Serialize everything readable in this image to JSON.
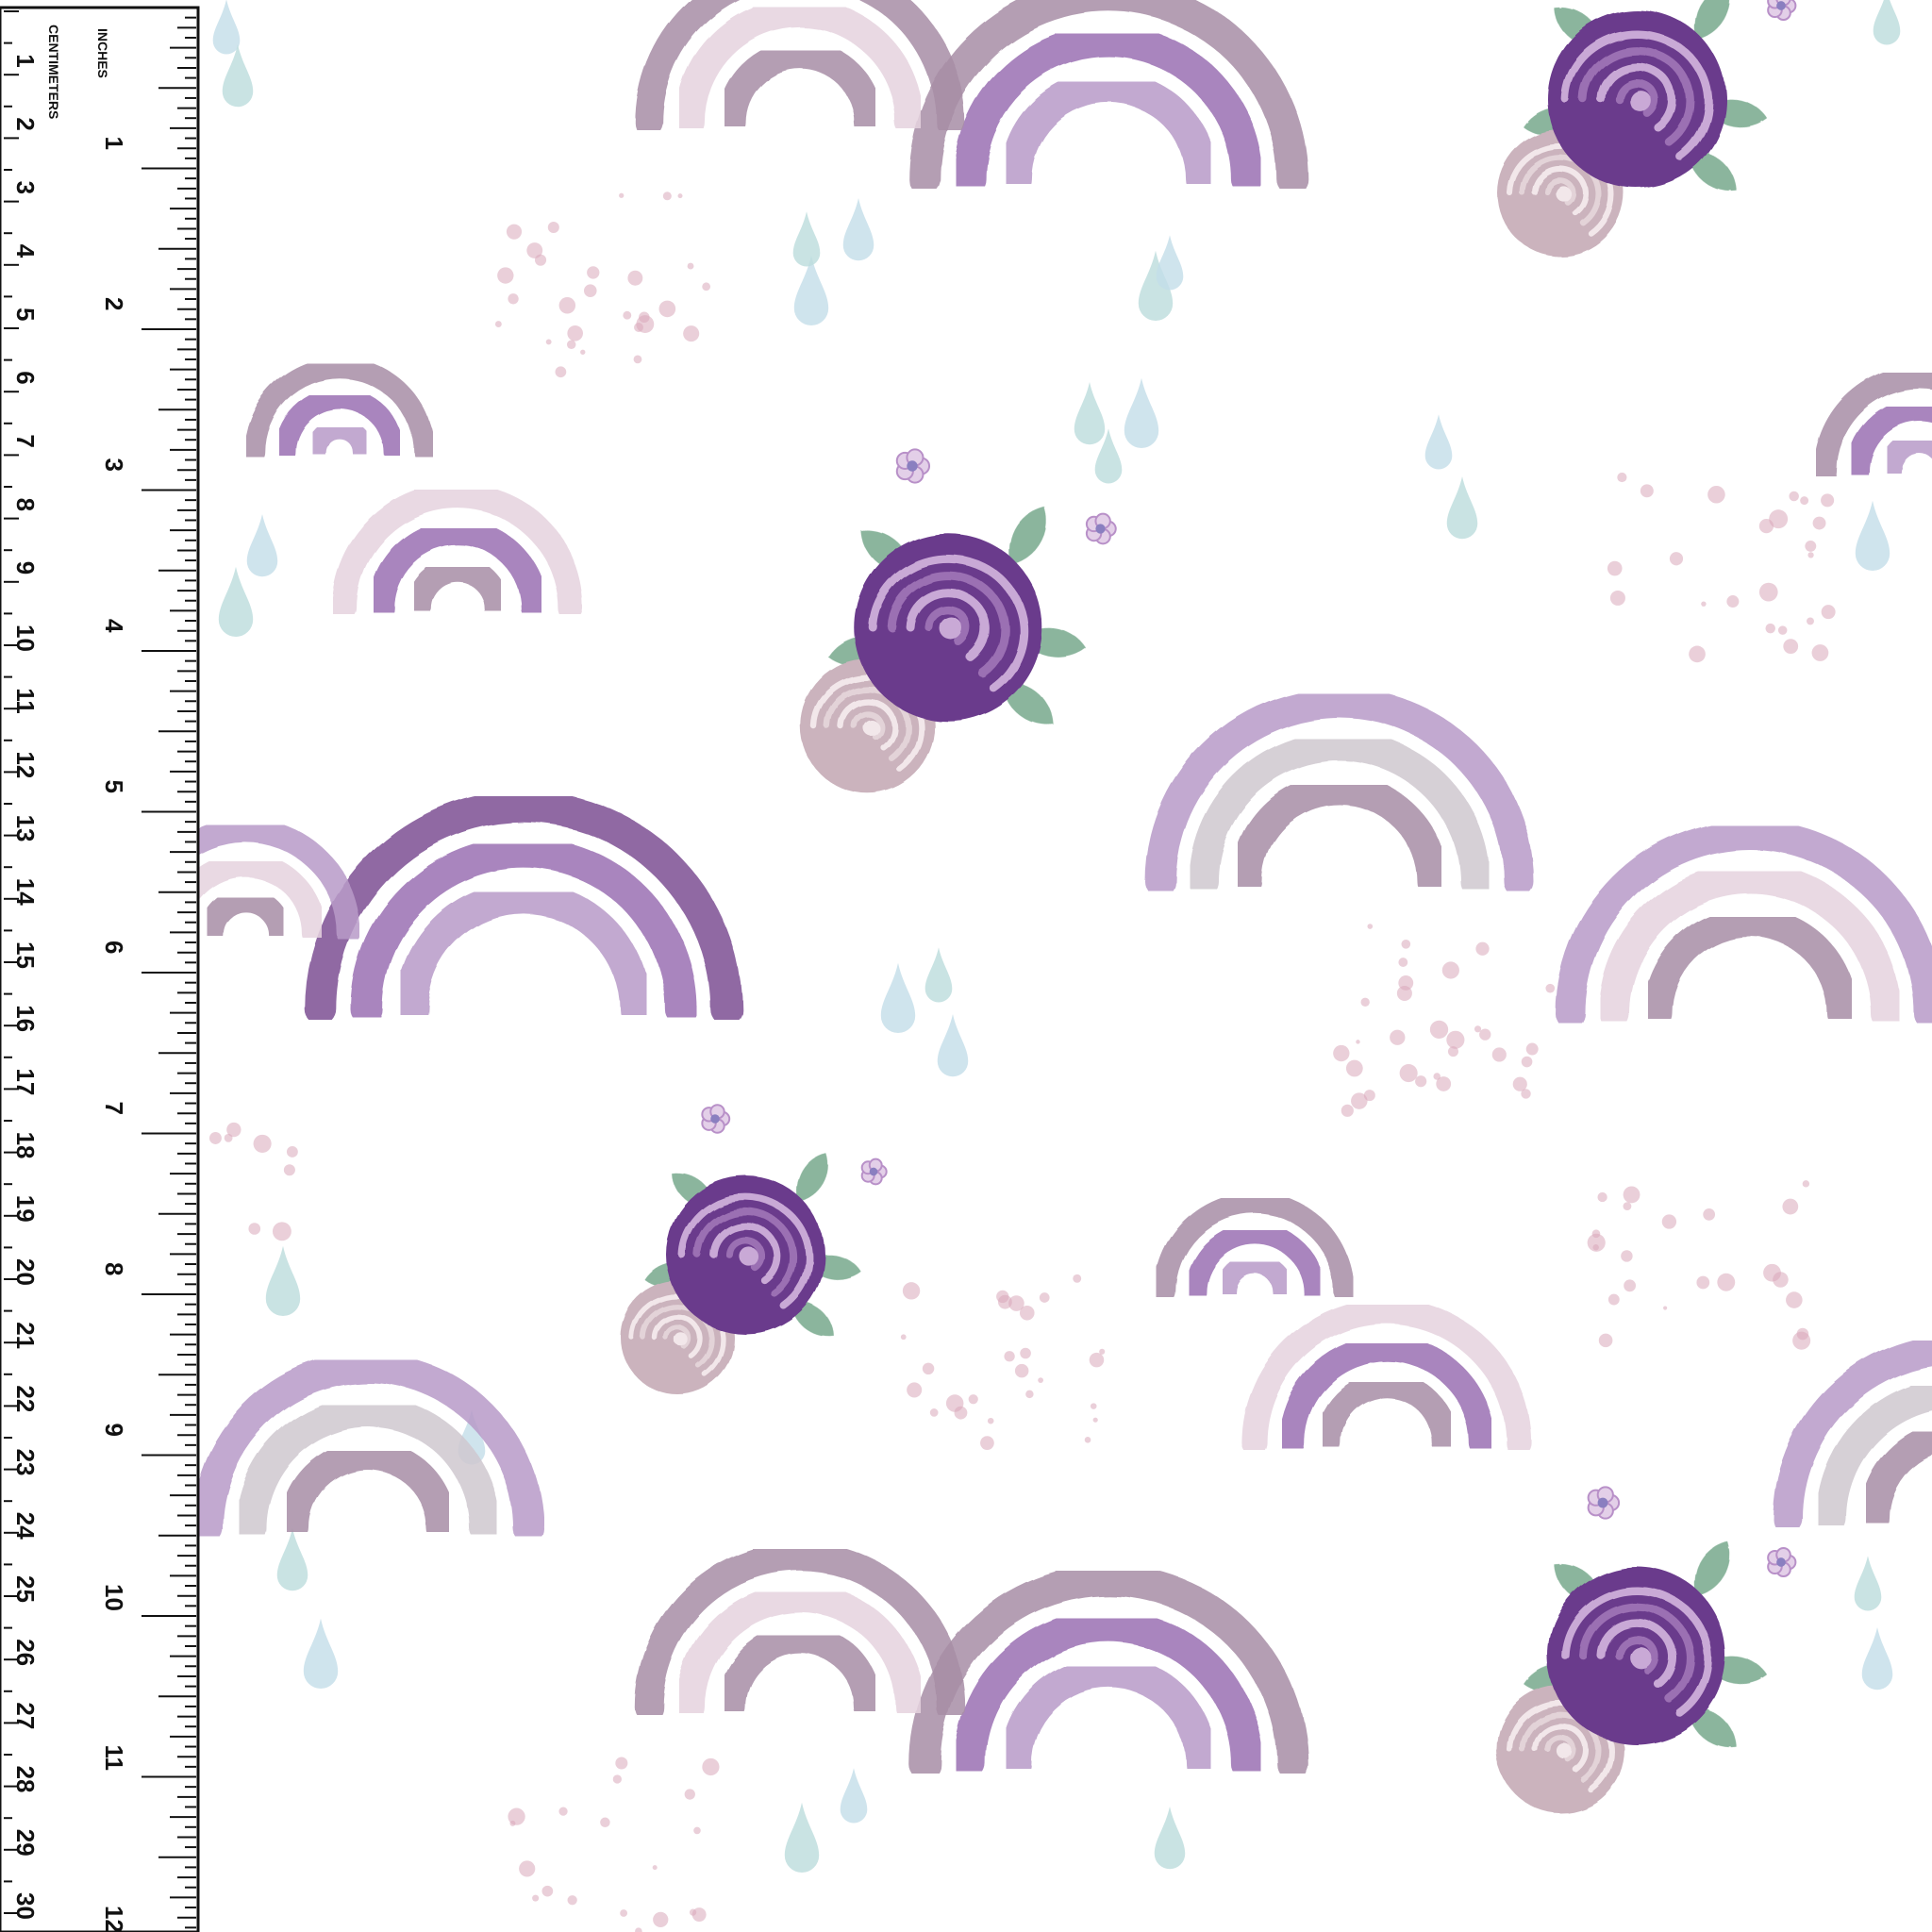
{
  "ruler": {
    "cm_label": "CENTIMETERS",
    "inch_label": "INCHES",
    "cm_numbers": [
      "1",
      "2",
      "3",
      "4",
      "5",
      "6",
      "7",
      "8",
      "9",
      "10",
      "11",
      "12",
      "13",
      "14",
      "15",
      "16",
      "17",
      "18",
      "19",
      "20",
      "21",
      "22",
      "23",
      "24",
      "25",
      "26",
      "27",
      "28",
      "29",
      "30"
    ],
    "inch_numbers": [
      "1",
      "2",
      "3",
      "4",
      "5",
      "6",
      "7",
      "8",
      "9",
      "10",
      "11",
      "12"
    ]
  },
  "colors": {
    "background": "#ffffff",
    "ruler_bg": "#ffffff",
    "ruler_ink": "#111111",
    "deep_purple": "#6b3a8c",
    "mid_purple": "#9b6fb3",
    "light_purple": "#b89bc8",
    "mauve": "#a88ea6",
    "pale_pink": "#e6d3df",
    "grey_lilac": "#cfc8d0",
    "leaf_green": "#7fae93",
    "raindrop": "#bcdcdc",
    "speckle": "#d9a7b9",
    "dusty_rose": "#cbb3bd"
  },
  "motifs": [
    "rainbow-icon",
    "rose-icon",
    "forget-me-not-icon",
    "leaf-icon",
    "raindrop-icon",
    "speckle-dots"
  ]
}
